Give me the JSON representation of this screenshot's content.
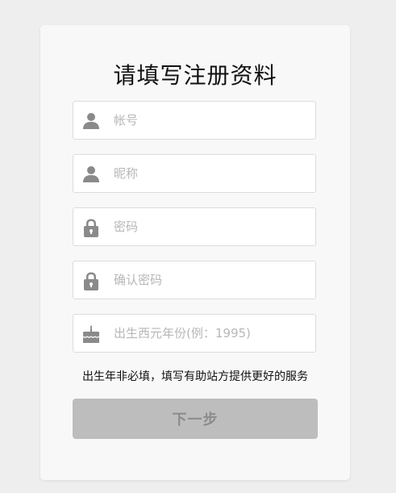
{
  "form": {
    "title": "请填写注册资料",
    "fields": [
      {
        "placeholder": "帐号",
        "value": "",
        "icon": "user-icon"
      },
      {
        "placeholder": "昵称",
        "value": "",
        "icon": "user-icon"
      },
      {
        "placeholder": "密码",
        "value": "",
        "icon": "lock-icon"
      },
      {
        "placeholder": "确认密码",
        "value": "",
        "icon": "lock-icon"
      },
      {
        "placeholder": "出生西元年份(例：1995)",
        "value": "",
        "icon": "birthday-cake-icon"
      }
    ],
    "birth_note": "出生年非必填，填写有助站方提供更好的服务",
    "next_label": "下一步"
  },
  "colors": {
    "page_background": "#eeeeee",
    "card_background": "#f8f8f8",
    "icon_color": "#8a8a8a",
    "button_background": "#bdbdbd",
    "button_text": "#8c8c8c"
  }
}
